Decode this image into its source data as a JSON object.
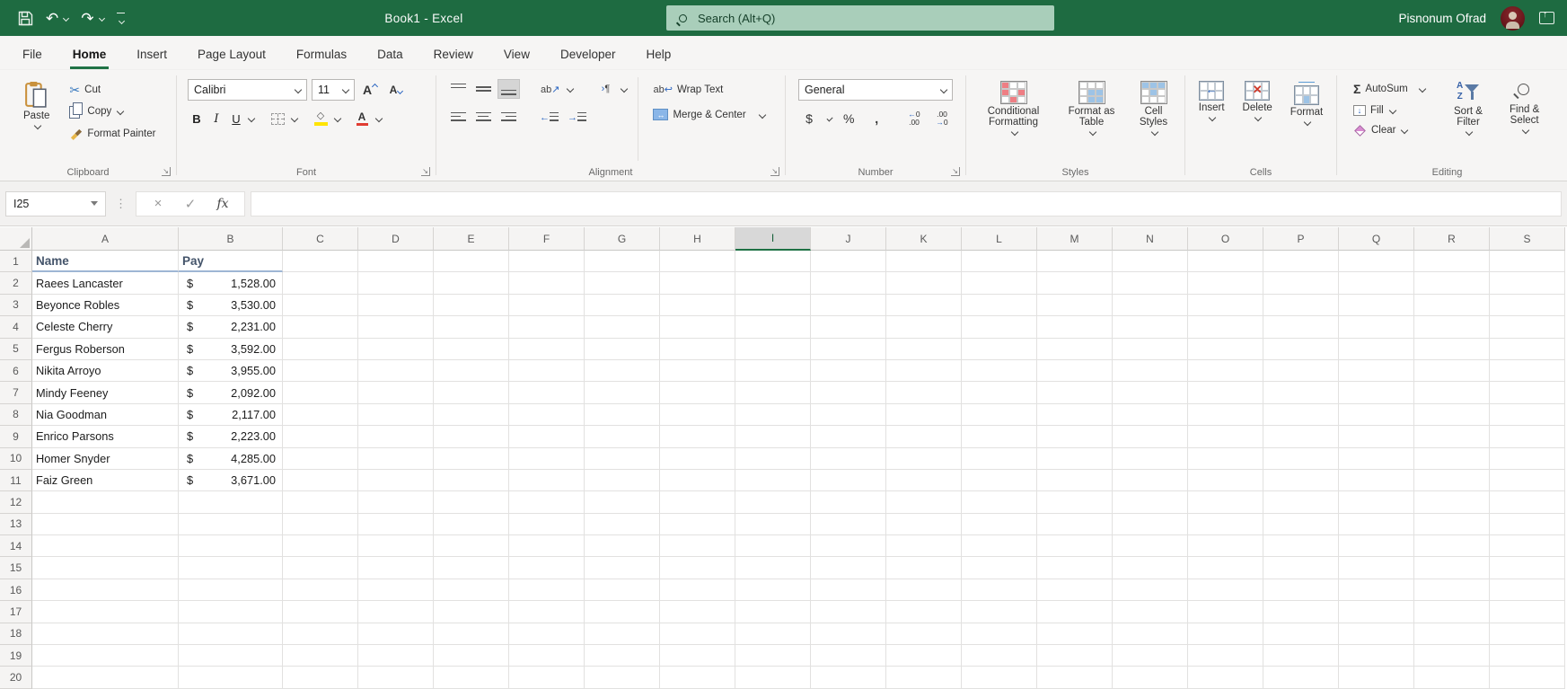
{
  "titlebar": {
    "title": "Book1 - Excel",
    "search_placeholder": "Search (Alt+Q)",
    "user_name": "Pisnonum Ofrad"
  },
  "tabs": {
    "items": [
      "File",
      "Home",
      "Insert",
      "Page Layout",
      "Formulas",
      "Data",
      "Review",
      "View",
      "Developer",
      "Help"
    ],
    "active": "Home"
  },
  "ribbon": {
    "clipboard": {
      "label": "Clipboard",
      "paste": "Paste",
      "cut": "Cut",
      "copy": "Copy",
      "format_painter": "Format Painter"
    },
    "font": {
      "label": "Font",
      "font_name": "Calibri",
      "font_size": "11",
      "bold": "B",
      "italic": "I",
      "underline": "U"
    },
    "alignment": {
      "label": "Alignment",
      "wrap_text": "Wrap Text",
      "merge_center": "Merge & Center"
    },
    "number": {
      "label": "Number",
      "format": "General",
      "currency": "$",
      "percent": "%",
      "comma": ",",
      "inc_dec_top": "←0",
      "inc_dec_bottom": ".00",
      "dec_dec_top": ".00",
      "dec_dec_bottom": "→0"
    },
    "styles": {
      "label": "Styles",
      "conditional_formatting": "Conditional Formatting",
      "format_as_table": "Format as Table",
      "cell_styles": "Cell Styles"
    },
    "cells": {
      "label": "Cells",
      "insert": "Insert",
      "delete": "Delete",
      "format": "Format"
    },
    "editing": {
      "label": "Editing",
      "autosum": "AutoSum",
      "fill": "Fill",
      "clear": "Clear",
      "sort_filter": "Sort & Filter",
      "find_select": "Find & Select"
    }
  },
  "formula_bar": {
    "name_box": "I25",
    "fx": "fx",
    "value": ""
  },
  "sheet": {
    "col_headers": [
      "A",
      "B",
      "C",
      "D",
      "E",
      "F",
      "G",
      "H",
      "I",
      "J",
      "K",
      "L",
      "M",
      "N",
      "O",
      "P",
      "Q",
      "R",
      "S"
    ],
    "selected_column": "I",
    "selected_cell": "I25",
    "row_count": 20,
    "currency_symbol": "$",
    "header_row": {
      "name": "Name",
      "pay": "Pay"
    },
    "records": [
      {
        "name": "Raees Lancaster",
        "pay": "1,528.00"
      },
      {
        "name": "Beyonce Robles",
        "pay": "3,530.00"
      },
      {
        "name": "Celeste Cherry",
        "pay": "2,231.00"
      },
      {
        "name": "Fergus Roberson",
        "pay": "3,592.00"
      },
      {
        "name": "Nikita Arroyo",
        "pay": "3,955.00"
      },
      {
        "name": "Mindy Feeney",
        "pay": "2,092.00"
      },
      {
        "name": "Nia Goodman",
        "pay": "2,117.00"
      },
      {
        "name": "Enrico Parsons",
        "pay": "2,223.00"
      },
      {
        "name": "Homer Snyder",
        "pay": "4,285.00"
      },
      {
        "name": "Faiz Green",
        "pay": "3,671.00"
      }
    ]
  },
  "colors": {
    "titlebar_green": "#1e6b41",
    "accent_green": "#217346",
    "search_bg": "#a9ceba",
    "selected_header_bg": "#d8d8d8",
    "heading_text": "#44546a",
    "row1_border_blue": "#9eb6d4"
  }
}
